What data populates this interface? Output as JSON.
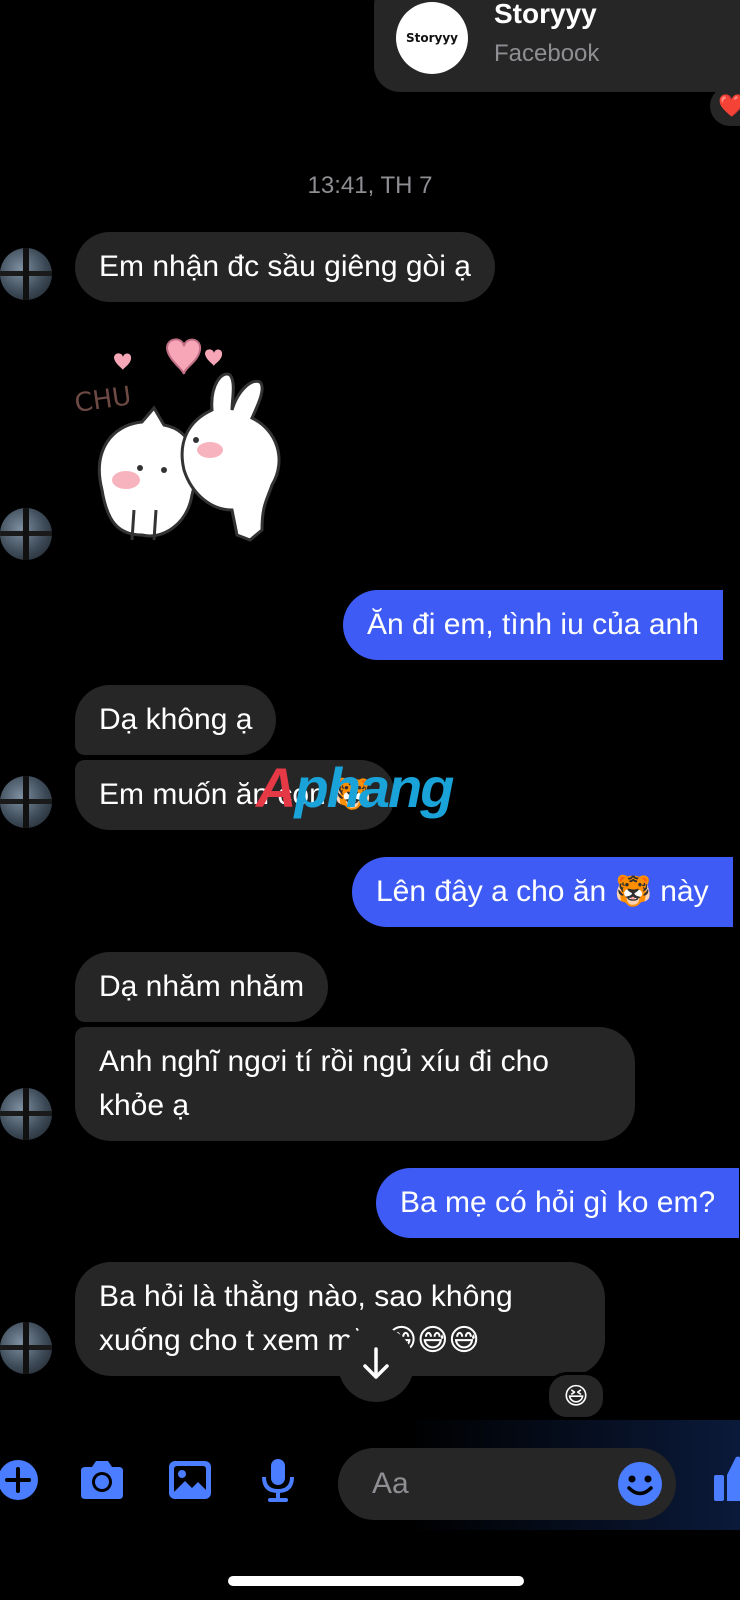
{
  "share_card": {
    "logo_text": "Storyyy",
    "title": "Storyyy",
    "source": "Facebook",
    "reaction": "❤️"
  },
  "timestamp": "13:41, TH 7",
  "messages": [
    {
      "dir": "in",
      "text": "Em nhận đc sầu giêng gòi ạ"
    },
    {
      "dir": "in",
      "sticker_text": "CHU"
    },
    {
      "dir": "out",
      "text": "Ăn đi em, tình iu của anh"
    },
    {
      "dir": "in",
      "text": "Dạ không ạ"
    },
    {
      "dir": "in",
      "text": "Em muốn ăn con 🐯"
    },
    {
      "dir": "out",
      "text": "Lên đây a cho ăn 🐯 này"
    },
    {
      "dir": "in",
      "text": "Dạ nhăm nhăm"
    },
    {
      "dir": "in",
      "text": "Anh nghĩ ngơi tí rồi ngủ xíu đi cho khỏe ạ"
    },
    {
      "dir": "out",
      "text": "Ba mẹ có hỏi gì ko em?"
    },
    {
      "dir": "in",
      "text": "Ba hỏi là thằng nào, sao không xuống cho t xem mặt 😁😅😅"
    }
  ],
  "last_reaction": "😆",
  "watermark": {
    "part1": "A",
    "part2": "phang"
  },
  "composer": {
    "placeholder": "Aa",
    "icons": [
      "plus-icon",
      "camera-icon",
      "gallery-icon",
      "microphone-icon",
      "emoji-icon",
      "thumbs-up-icon"
    ]
  },
  "colors": {
    "background": "#000000",
    "incoming_bubble": "#262626",
    "outgoing_bubble": "#3e5cf5",
    "icon_blue": "#4a7dff"
  }
}
